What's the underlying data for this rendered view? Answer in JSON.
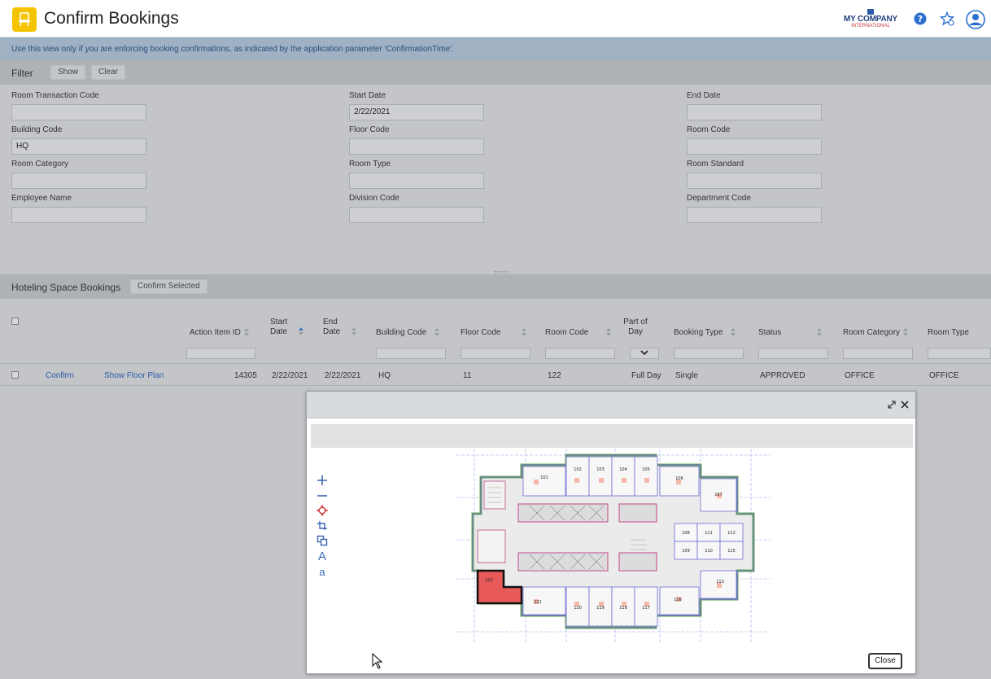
{
  "header": {
    "title": "Confirm Bookings",
    "brand_name": "MY COMPANY",
    "brand_sub": "INTERNATIONAL"
  },
  "info": {
    "message": "Use this view only if you are enforcing booking confirmations, as indicated by the application parameter 'ConfirmationTime'."
  },
  "filter": {
    "title": "Filter",
    "show_label": "Show",
    "clear_label": "Clear",
    "fields": [
      {
        "label": "Room Transaction Code",
        "value": ""
      },
      {
        "label": "Start Date",
        "value": "2/22/2021"
      },
      {
        "label": "End Date",
        "value": ""
      },
      {
        "label": "Building Code",
        "value": "HQ"
      },
      {
        "label": "Floor Code",
        "value": ""
      },
      {
        "label": "Room Code",
        "value": ""
      },
      {
        "label": "Room Category",
        "value": ""
      },
      {
        "label": "Room Type",
        "value": ""
      },
      {
        "label": "Room Standard",
        "value": ""
      },
      {
        "label": "Employee Name",
        "value": ""
      },
      {
        "label": "Division Code",
        "value": ""
      },
      {
        "label": "Department Code",
        "value": ""
      }
    ]
  },
  "grid": {
    "title": "Hoteling Space Bookings",
    "confirm_selected_label": "Confirm Selected",
    "columns": {
      "action_item_id": "Action Item ID",
      "start_date_1": "Start",
      "start_date_2": "Date",
      "end_date_1": "End",
      "end_date_2": "Date",
      "building_code": "Building Code",
      "floor_code": "Floor Code",
      "room_code": "Room Code",
      "part_of_day_1": "Part of",
      "part_of_day_2": "Day",
      "booking_type": "Booking Type",
      "status": "Status",
      "room_category": "Room Category",
      "room_type": "Room Type"
    },
    "rows": [
      {
        "confirm": "Confirm",
        "show_floor_plan": "Show Floor Plan",
        "action_item_id": "14305",
        "start_date": "2/22/2021",
        "end_date": "2/22/2021",
        "building_code": "HQ",
        "floor_code": "11",
        "room_code": "122",
        "part_of_day": "Full Day",
        "booking_type": "Single",
        "status": "APPROVED",
        "room_category": "OFFICE",
        "room_type": "OFFICE"
      }
    ]
  },
  "dialog": {
    "close_label": "Close",
    "plan_rooms": [
      "101",
      "102",
      "103",
      "104",
      "105",
      "106",
      "107",
      "108",
      "109",
      "110",
      "111",
      "112",
      "113",
      "115",
      "116",
      "117",
      "118",
      "119",
      "120",
      "121",
      "122"
    ],
    "highlight_room": "122",
    "highlight_color": "#e85a5a"
  },
  "colors": {
    "accent": "#f5c400",
    "link": "#2b5ca8",
    "info_bg": "#9fb1c3",
    "panel_bar": "#afb2b5",
    "overlay_bg": "#c3c5c8"
  }
}
